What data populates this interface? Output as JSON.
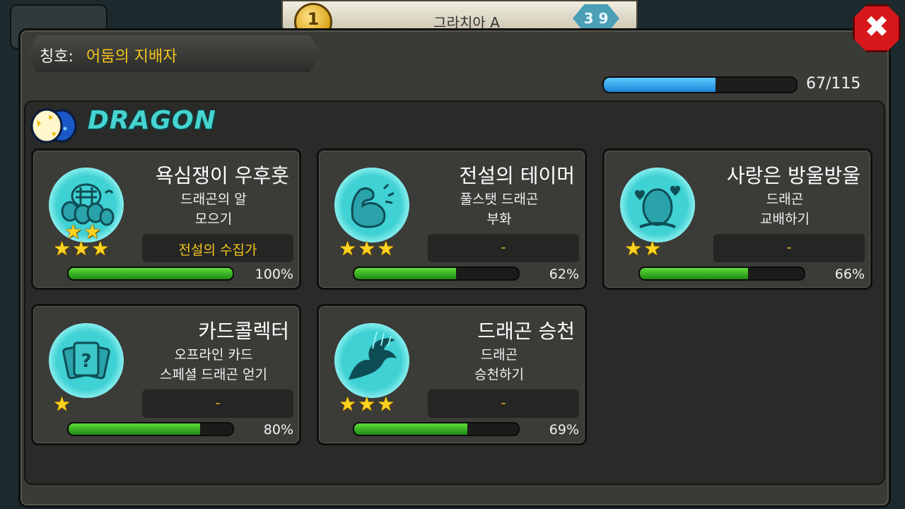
{
  "background": {
    "coin_number": "1",
    "player_name": "그라치아 A",
    "badge_value": "3 9"
  },
  "header": {
    "title_label": "칭호:",
    "title_value": "어둠의 지배자",
    "progress_value": 67,
    "progress_max": 115,
    "progress_text": "67/115"
  },
  "category": {
    "name": "DRAGON",
    "icon": "dragon-eggs-icon"
  },
  "achievements": [
    {
      "title": "욕심쟁이 우후훗",
      "desc_line1": "드래곤의 알",
      "desc_line2": "모으기",
      "reward": "전설의 수집가",
      "stars": "★★★",
      "stars_extra": "★★",
      "progress": 1.0,
      "percent": "100%",
      "icon": "egg-pile-icon"
    },
    {
      "title": "전설의 테이머",
      "desc_line1": "풀스탯 드래곤",
      "desc_line2": "부화",
      "reward": "-",
      "stars": "★★★",
      "stars_extra": "",
      "progress": 0.62,
      "percent": "62%",
      "icon": "flexed-arm-icon"
    },
    {
      "title": "사랑은 방울방울",
      "desc_line1": "드래곤",
      "desc_line2": "교배하기",
      "reward": "-",
      "stars": "★★",
      "stars_extra": "",
      "progress": 0.66,
      "percent": "66%",
      "icon": "egg-hearts-icon"
    },
    {
      "title": "카드콜렉터",
      "desc_line1": "오프라인 카드",
      "desc_line2": "스페셜 드래곤 얻기",
      "reward": "-",
      "stars": "★",
      "stars_extra": "",
      "progress": 0.8,
      "percent": "80%",
      "icon": "question-cards-icon"
    },
    {
      "title": "드래곤 승천",
      "desc_line1": "드래곤",
      "desc_line2": "승천하기",
      "reward": "-",
      "stars": "★★★",
      "stars_extra": "",
      "progress": 0.69,
      "percent": "69%",
      "icon": "ascending-dragon-icon"
    }
  ],
  "close_button": {
    "label": "✖",
    "icon": "close-icon"
  },
  "colors": {
    "title_gold": "#f4c51c",
    "progress_blue": "#1b86d8",
    "bar_green": "#2fae1d",
    "medal_teal": "#3fd1d3",
    "close_red": "#d8171b"
  }
}
